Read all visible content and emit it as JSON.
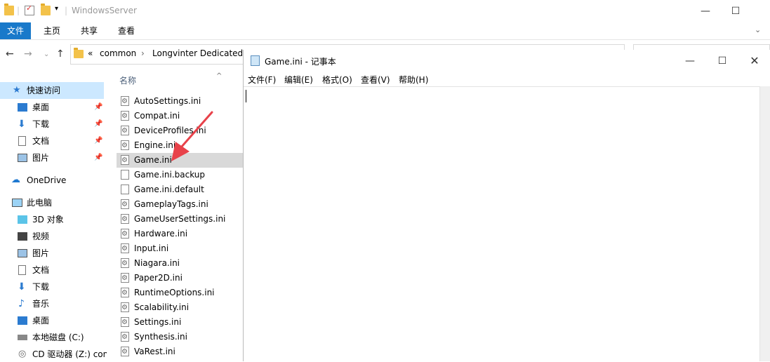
{
  "explorer": {
    "title": "WindowsServer",
    "ribbon_tabs": [
      "文件",
      "主页",
      "共享",
      "查看"
    ],
    "address": {
      "prefix": "«",
      "crumbs": [
        "common",
        "Longvinter Dedicated"
      ]
    },
    "column_name": "名称"
  },
  "nav": {
    "quick_access": "快速访问",
    "qa_items": [
      "桌面",
      "下载",
      "文档",
      "图片"
    ],
    "onedrive": "OneDrive",
    "this_pc": "此电脑",
    "pc_items": [
      "3D 对象",
      "视频",
      "图片",
      "文档",
      "下载",
      "音乐",
      "桌面",
      "本地磁盘 (C:)",
      "CD 驱动器 (Z:) con"
    ]
  },
  "files": [
    "AutoSettings.ini",
    "Compat.ini",
    "DeviceProfiles.ini",
    "Engine.ini",
    "Game.ini",
    "Game.ini.backup",
    "Game.ini.default",
    "GameplayTags.ini",
    "GameUserSettings.ini",
    "Hardware.ini",
    "Input.ini",
    "Niagara.ini",
    "Paper2D.ini",
    "RuntimeOptions.ini",
    "Scalability.ini",
    "Settings.ini",
    "Synthesis.ini",
    "VaRest.ini"
  ],
  "selected_file": "Game.ini",
  "notepad": {
    "title": "Game.ini - 记事本",
    "menu": [
      "文件(F)",
      "编辑(E)",
      "格式(O)",
      "查看(V)",
      "帮助(H)"
    ],
    "content": ""
  },
  "colors": {
    "ribbon_active": "#1979ca",
    "nav_selected": "#cce8ff",
    "arrow": "#e8424a"
  },
  "icons": [
    "folder-icon",
    "checklist-icon",
    "star-icon",
    "desktop-icon",
    "download-icon",
    "document-icon",
    "picture-icon",
    "onedrive-icon",
    "computer-icon",
    "cube-icon",
    "video-icon",
    "music-icon",
    "drive-icon",
    "cd-icon",
    "gear-file-icon",
    "notepad-icon",
    "pin-icon"
  ]
}
